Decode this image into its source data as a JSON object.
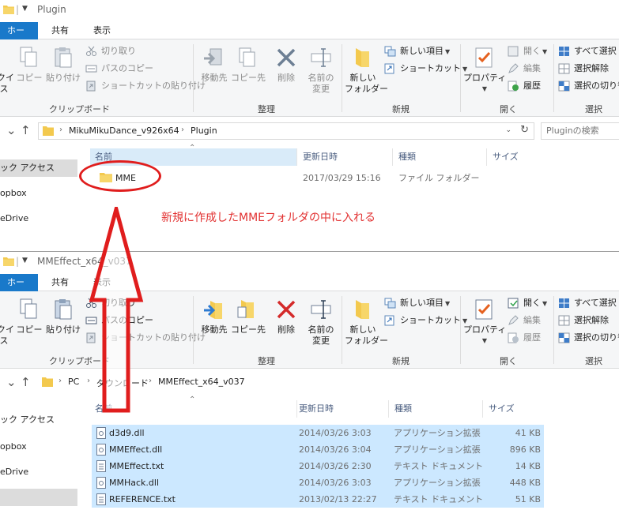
{
  "window_top": {
    "title": "Plugin",
    "tabs": [
      "ホーム",
      "共有",
      "表示"
    ],
    "ribbon": {
      "clipboard": {
        "pin_label_line1": "クイ",
        "pin_label_line2": "ス",
        "copy": "コピー",
        "paste": "貼り付け",
        "cut": "切り取り",
        "copy_path": "パスのコピー",
        "paste_shortcut": "ショートカットの貼り付け",
        "group": "クリップボード"
      },
      "organize": {
        "move_to": "移動先",
        "copy_to": "コピー先",
        "delete": "削除",
        "rename_line1": "名前の",
        "rename_line2": "変更",
        "group": "整理"
      },
      "new": {
        "new_folder_line1": "新しい",
        "new_folder_line2": "フォルダー",
        "new_item": "新しい項目",
        "shortcut": "ショートカット",
        "group": "新規"
      },
      "open": {
        "properties": "プロパティ",
        "open": "開く",
        "edit": "編集",
        "history": "履歴",
        "group": "開く"
      },
      "select": {
        "select_all": "すべて選択",
        "select_none": "選択解除",
        "invert_selection": "選択の切り替",
        "group": "選択"
      }
    },
    "address": {
      "crumbs": [
        "MikuMikuDance_v926x64",
        "Plugin"
      ],
      "search_placeholder": "Pluginの検索"
    },
    "nav": [
      "ック アクセス",
      "opbox",
      "eDrive"
    ],
    "columns": {
      "name": "名前",
      "modified": "更新日時",
      "type": "種類",
      "size": "サイズ"
    },
    "files": [
      {
        "name": "MME",
        "modified": "2017/03/29 15:16",
        "type": "ファイル フォルダー",
        "size": ""
      }
    ]
  },
  "window_bottom": {
    "title": "MMEffect_x64_v037",
    "tabs": [
      "ホーム",
      "共有",
      "表示"
    ],
    "ribbon": {
      "clipboard": {
        "pin_label_line1": "クイ",
        "pin_label_line2": "ス",
        "copy": "コピー",
        "paste": "貼り付け",
        "cut": "切り取り",
        "copy_path": "パスのコピー",
        "paste_shortcut": "ショートカットの貼り付け",
        "group": "クリップボード"
      },
      "organize": {
        "move_to": "移動先",
        "copy_to": "コピー先",
        "delete": "削除",
        "rename_line1": "名前の",
        "rename_line2": "変更",
        "group": "整理"
      },
      "new": {
        "new_folder_line1": "新しい",
        "new_folder_line2": "フォルダー",
        "new_item": "新しい項目",
        "shortcut": "ショートカット",
        "group": "新規"
      },
      "open": {
        "properties": "プロパティ",
        "open": "開く",
        "edit": "編集",
        "history": "履歴",
        "group": "開く"
      },
      "select": {
        "select_all": "すべて選択",
        "select_none": "選択解除",
        "invert_selection": "選択の切り替",
        "group": "選択"
      }
    },
    "address": {
      "crumbs": [
        "PC",
        "ダウンロード",
        "MMEffect_x64_v037"
      ]
    },
    "nav": [
      "ック アクセス",
      "opbox",
      "eDrive"
    ],
    "columns": {
      "name": "名前",
      "modified": "更新日時",
      "type": "種類",
      "size": "サイズ"
    },
    "files": [
      {
        "name": "d3d9.dll",
        "modified": "2014/03/26 3:03",
        "type": "アプリケーション拡張",
        "size": "41 KB"
      },
      {
        "name": "MMEffect.dll",
        "modified": "2014/03/26 3:04",
        "type": "アプリケーション拡張",
        "size": "896 KB"
      },
      {
        "name": "MMEffect.txt",
        "modified": "2014/03/26 2:30",
        "type": "テキスト ドキュメント",
        "size": "14 KB"
      },
      {
        "name": "MMHack.dll",
        "modified": "2014/03/26 3:03",
        "type": "アプリケーション拡張",
        "size": "448 KB"
      },
      {
        "name": "REFERENCE.txt",
        "modified": "2013/02/13 22:27",
        "type": "テキスト ドキュメント",
        "size": "51 KB"
      }
    ]
  },
  "annotation": {
    "callout": "新規に作成したMMEフォルダの中に入れる",
    "color": "#e01d1d"
  },
  "colors": {
    "accent": "#1979ca",
    "selection": "#cce8ff",
    "folder": "#f3c94e"
  }
}
